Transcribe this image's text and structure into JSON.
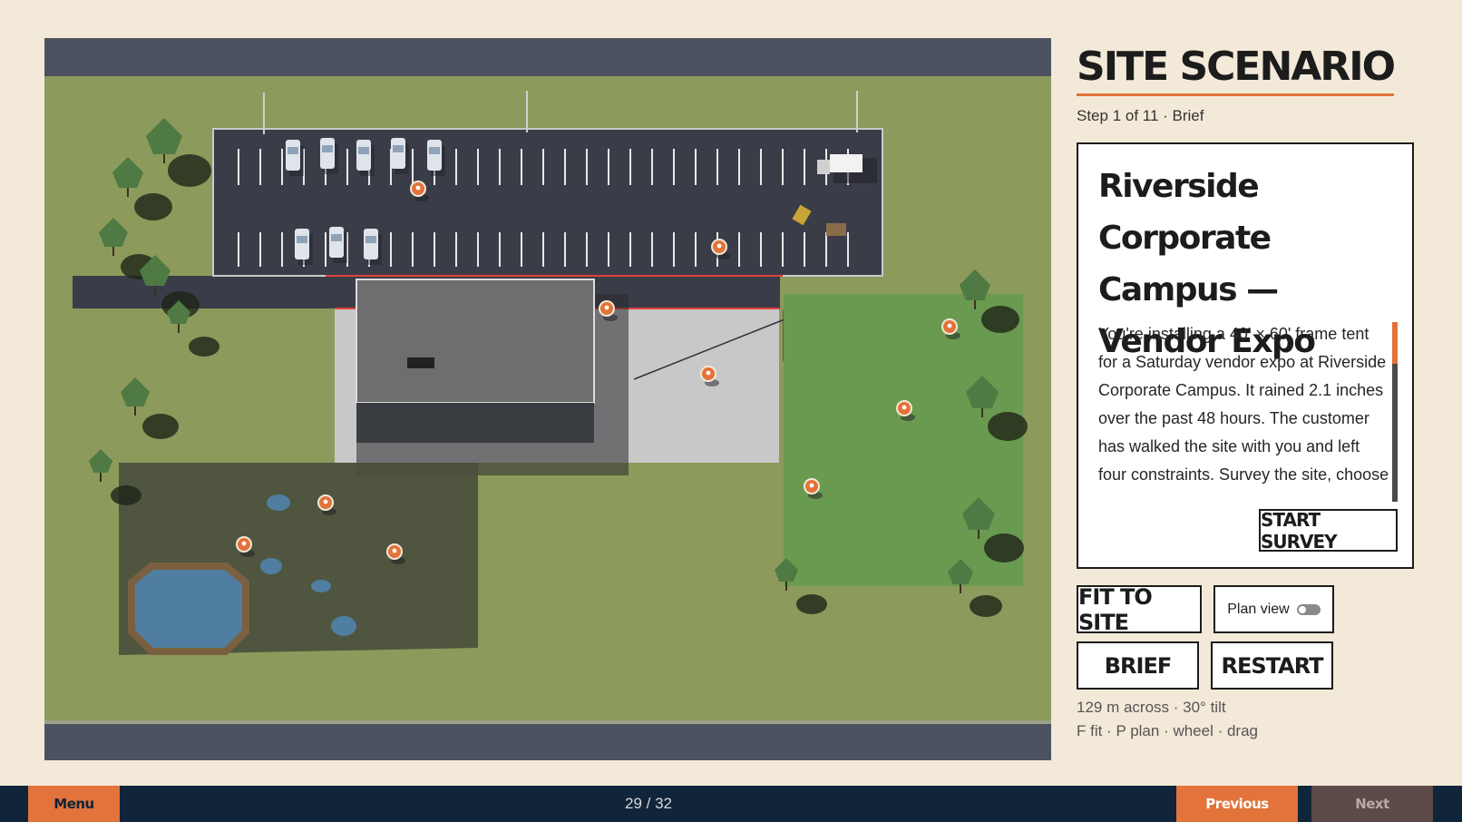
{
  "sidebar": {
    "title": "SITE SCENARIO",
    "step": "Step 1 of 11 · Brief",
    "brief_title": "Riverside Corporate Campus — Vendor Expo",
    "brief_text": "You're installing a 40' × 60' frame tent for a Saturday vendor expo at Riverside Corporate Campus. It rained 2.1 inches over the past 48 hours. The customer has walked the site with you and left four constraints. Survey the site, choose a location, and",
    "start_survey": "START SURVEY",
    "fit_to_site": "FIT TO SITE",
    "plan_view": "Plan view",
    "plan_view_on": false,
    "brief_button": "BRIEF",
    "restart_button": "RESTART",
    "camera_info": "129 m across · 30° tilt",
    "shortcuts": "F fit · P plan · wheel · drag",
    "brief_scroll_fraction": 0.0
  },
  "bottombar": {
    "menu": "Menu",
    "page": "29 / 32",
    "previous": "Previous",
    "next": "Next"
  },
  "scene": {
    "survey_markers_count": 11,
    "colors": {
      "grass": "#8c9a5c",
      "lawn": "#6a9a50",
      "wetland": "#4a4f3c",
      "parking": "#3a3d48",
      "road": "#4d5260",
      "accent": "#e2733a",
      "water": "#4f7ea0"
    }
  }
}
